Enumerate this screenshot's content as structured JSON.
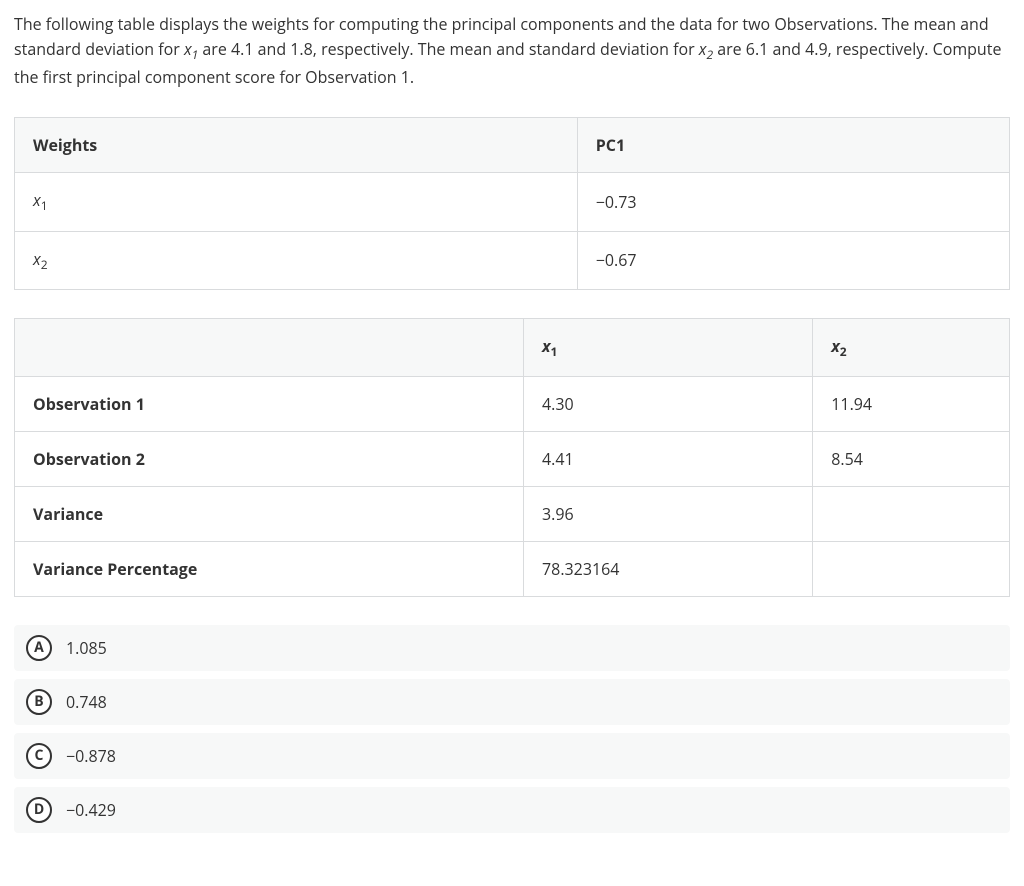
{
  "question": {
    "part1": "The following table displays the weights for computing the principal components and the data for two Observations. The mean and standard deviation for ",
    "var1": "x",
    "var1sub": "1",
    "part2": " are 4.1 and 1.8, respectively. The mean and standard deviation for ",
    "var2": "x",
    "var2sub": "2",
    "part3": " are 6.1 and 4.9, respectively. Compute the first principal component score for Observation 1."
  },
  "weights_table": {
    "header": {
      "c1": "Weights",
      "c2": "PC1"
    },
    "rows": [
      {
        "label": "x",
        "sub": "1",
        "value": "−0.73"
      },
      {
        "label": "x",
        "sub": "2",
        "value": "−0.67"
      }
    ]
  },
  "data_table": {
    "header": {
      "c1": "",
      "c2": "x",
      "c2sub": "1",
      "c3": "x",
      "c3sub": "2"
    },
    "rows": [
      {
        "label": "Observation 1",
        "x1": "4.30",
        "x2": "11.94"
      },
      {
        "label": "Observation 2",
        "x1": "4.41",
        "x2": "8.54"
      },
      {
        "label": "Variance",
        "x1": "3.96",
        "x2": ""
      },
      {
        "label": "Variance Percentage",
        "x1": "78.323164",
        "x2": ""
      }
    ]
  },
  "options": [
    {
      "letter": "A",
      "text": "1.085"
    },
    {
      "letter": "B",
      "text": "0.748"
    },
    {
      "letter": "C",
      "text": "−0.878"
    },
    {
      "letter": "D",
      "text": "−0.429"
    }
  ]
}
